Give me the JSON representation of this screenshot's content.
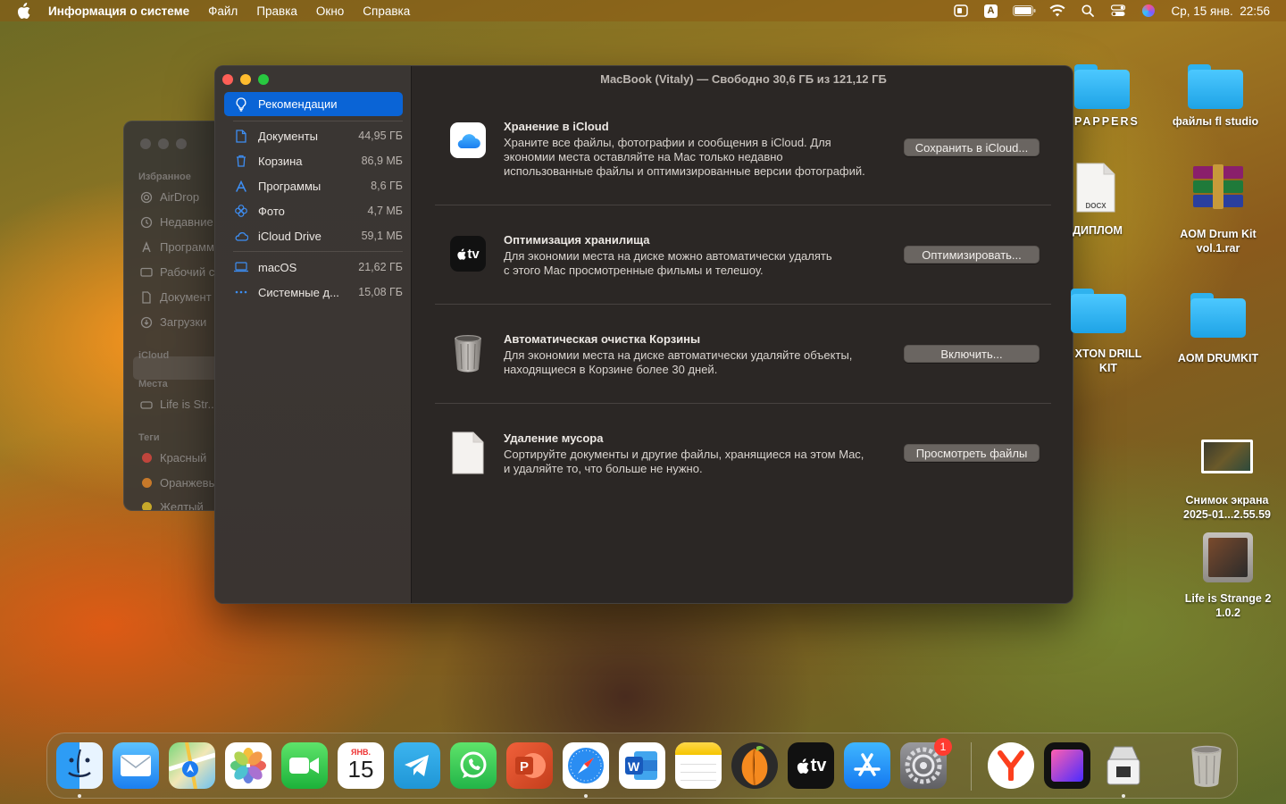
{
  "menubar": {
    "app_name": "Информация о системе",
    "items": [
      "Файл",
      "Правка",
      "Окно",
      "Справка"
    ],
    "input_source": "A",
    "clock": "Ср, 15 янв.  22:56"
  },
  "finder_bg": {
    "sections": [
      "Избранное",
      "iCloud",
      "Места",
      "Теги"
    ],
    "favorites": [
      "AirDrop",
      "Недавние",
      "Программы",
      "Рабочий с",
      "Документ",
      "Загрузки"
    ],
    "places": [
      "Life is Str..."
    ],
    "tags": [
      {
        "label": "Красный",
        "color": "#c0453c"
      },
      {
        "label": "Оранжевы",
        "color": "#c7792a"
      },
      {
        "label": "Желтый",
        "color": "#c7a92a"
      }
    ]
  },
  "window": {
    "title": "MacBook (Vitaly) — Свободно 30,6 ГБ из 121,12 ГБ",
    "selected": "Рекомендации",
    "sidebar": [
      {
        "label": "Документы",
        "size": "44,95 ГБ",
        "icon": "document-icon"
      },
      {
        "label": "Корзина",
        "size": "86,9 МБ",
        "icon": "trash-icon"
      },
      {
        "label": "Программы",
        "size": "8,6 ГБ",
        "icon": "apps-icon"
      },
      {
        "label": "Фото",
        "size": "4,7 МБ",
        "icon": "photos-icon"
      },
      {
        "label": "iCloud Drive",
        "size": "59,1 МБ",
        "icon": "cloud-icon"
      },
      {
        "label": "macOS",
        "size": "21,62 ГБ",
        "icon": "laptop-icon"
      },
      {
        "label": "Системные д...",
        "size": "15,08 ГБ",
        "icon": "ellipsis-icon"
      }
    ],
    "recommendations": [
      {
        "title": "Хранение в iCloud",
        "desc": [
          "Храните все файлы, фотографии и сообщения в iCloud. Для",
          "экономии места оставляйте на Mac только недавно",
          "использованные файлы и оптимизированные версии фотографий."
        ],
        "button": "Сохранить в iCloud..."
      },
      {
        "title": "Оптимизация хранилища",
        "desc": [
          "Для экономии места на диске можно автоматически удалять",
          "с этого Mac просмотренные фильмы и телешоу."
        ],
        "button": "Оптимизировать..."
      },
      {
        "title": "Автоматическая очистка Корзины",
        "desc": [
          "Для экономии места на диске автоматически удаляйте объекты,",
          "находящиеся в Корзине более 30 дней."
        ],
        "button": "Включить..."
      },
      {
        "title": "Удаление мусора",
        "desc": [
          "Сортируйте документы и другие файлы, хранящиеся на этом Mac,",
          "и удаляйте то, что больше не нужно."
        ],
        "button": "Просмотреть файлы"
      }
    ],
    "tv_label": "tv"
  },
  "desktop": {
    "icons": [
      {
        "label": "PAPPERS"
      },
      {
        "label": "файлы fl studio"
      },
      {
        "label": "ДИПЛОМ",
        "ext": "DOCX"
      },
      {
        "label": "AOM Drum Kit vol.1.rar"
      },
      {
        "label": "XTON DRILL KIT"
      },
      {
        "label": "AOM DRUMKIT"
      },
      {
        "label": "Снимок экрана 2025-01...2.55.59"
      },
      {
        "label": "Life is Strange 2 1.0.2"
      }
    ]
  },
  "dock": {
    "apps": [
      "Finder",
      "Mail",
      "Maps",
      "Photos",
      "FaceTime",
      "Calendar",
      "Telegram",
      "WhatsApp",
      "PowerPoint",
      "Safari",
      "Word",
      "Notes",
      "FL Studio",
      "TV",
      "App Store",
      "System Settings",
      "Yandex",
      "GTA Vice City",
      "Installer",
      "Trash"
    ],
    "calendar_month": "ЯНВ.",
    "calendar_day": "15",
    "settings_badge": "1",
    "tv_label": "tv"
  }
}
